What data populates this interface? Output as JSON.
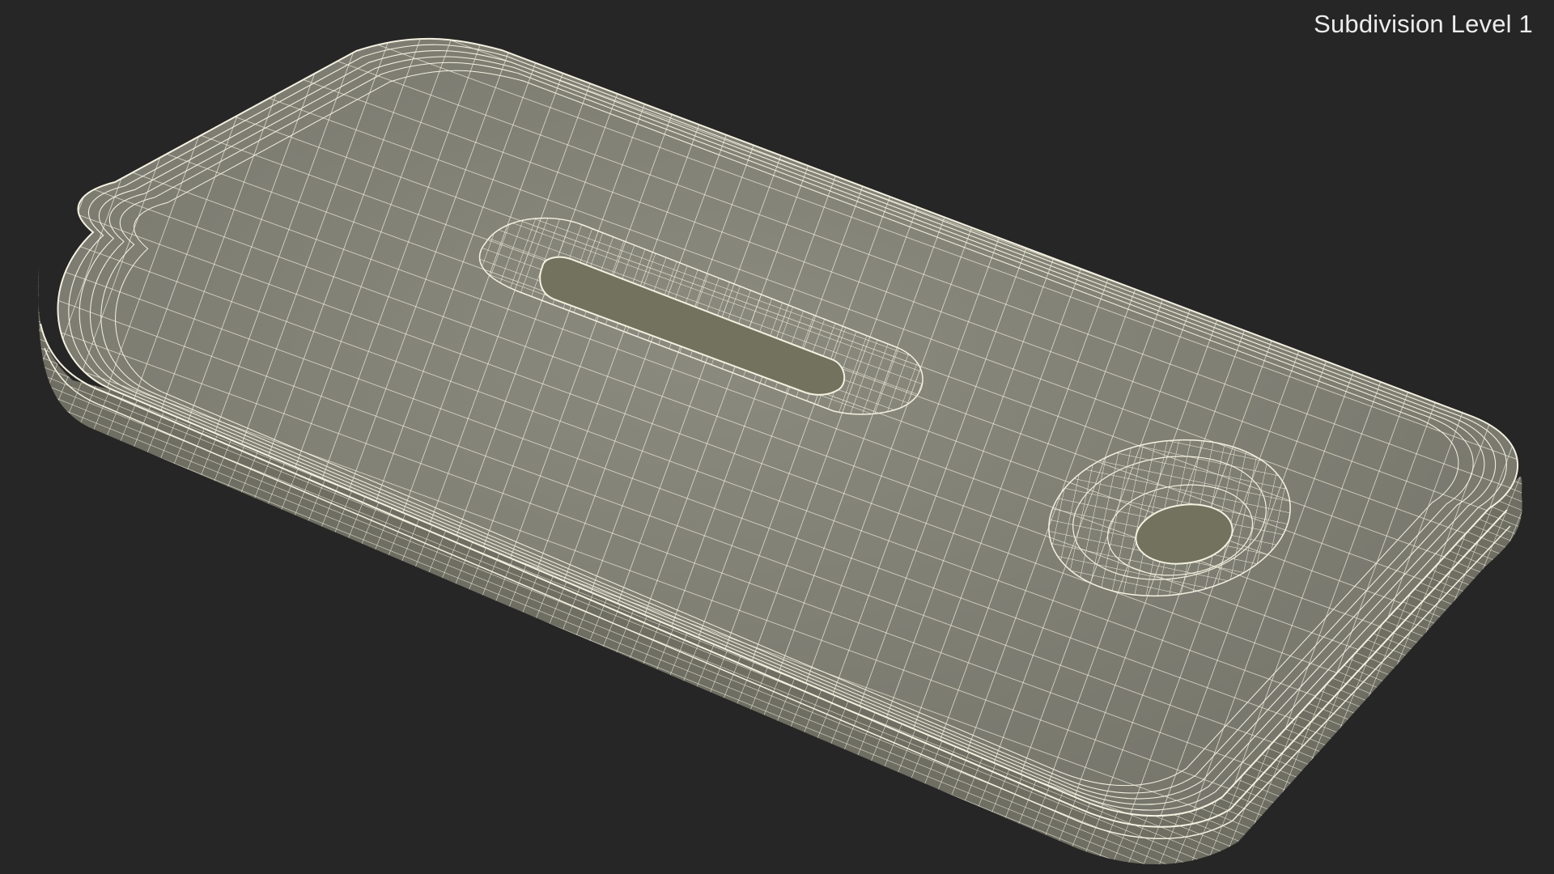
{
  "viewport": {
    "label": "Subdivision Level 1",
    "background_color": "#262626",
    "label_color": "#ececec"
  },
  "model": {
    "surface_color": "#7e7e72",
    "side_color": "#6e6e63",
    "recess_color": "#72725f",
    "wire_color": "#f4f1e0"
  }
}
